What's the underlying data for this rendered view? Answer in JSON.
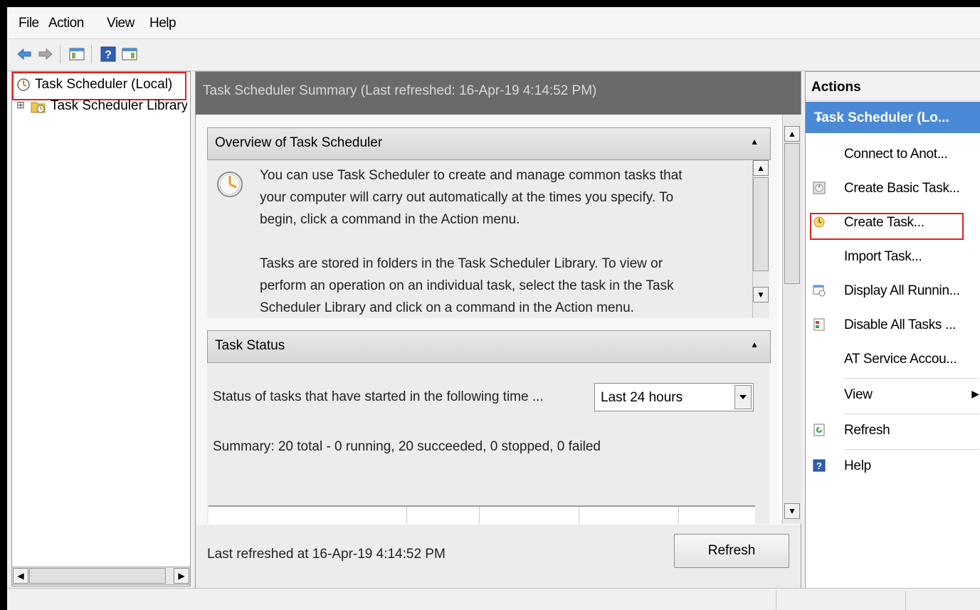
{
  "menu": [
    "File",
    "Action",
    "View",
    "Help"
  ],
  "toolbar": {
    "buttons": [
      "back-arrow-icon",
      "forward-arrow-icon",
      "show-hide-console-tree-icon",
      "help-icon",
      "show-hide-action-pane-icon"
    ]
  },
  "tree": {
    "items": [
      {
        "label": "Task Scheduler (Local)",
        "icon": "clock-icon"
      },
      {
        "label": "Task Scheduler Library",
        "icon": "folder-clock-icon",
        "expander": "⊞"
      }
    ]
  },
  "main": {
    "header": "Task Scheduler Summary (Last refreshed: 16-Apr-19 4:14:52 PM)",
    "overview": {
      "title": "Overview of Task Scheduler",
      "line1": "You can use Task Scheduler to create and manage common tasks that",
      "line2": "your computer will carry out automatically at the times you specify. To",
      "line3": "begin, click a command in the Action menu.",
      "line4": "Tasks are stored in folders in the Task Scheduler Library. To view or",
      "line5": "perform an operation on an individual task, select the task in the Task",
      "line6": "Scheduler Library and click on a command in the Action menu."
    },
    "status": {
      "title": "Task Status",
      "prompt": "Status of tasks that have started in the following time ...",
      "range_value": "Last 24 hours",
      "summary": "Summary: 20 total - 0 running, 20 succeeded, 0 stopped, 0 failed"
    },
    "footer": {
      "last_refreshed": "Last refreshed at 16-Apr-19 4:14:52 PM",
      "refresh_label": "Refresh"
    }
  },
  "actions": {
    "header": "Actions",
    "group": "Task Scheduler (Lo...",
    "items": [
      {
        "label": "Connect to Anot...",
        "icon": ""
      },
      {
        "label": "Create Basic Task...",
        "icon": "wizard-icon"
      },
      {
        "label": "Create Task...",
        "icon": "create-task-icon"
      },
      {
        "label": "Import Task...",
        "icon": ""
      },
      {
        "label": "Display All Runnin...",
        "icon": "running-tasks-icon"
      },
      {
        "label": "Disable All Tasks ...",
        "icon": "disable-icon"
      },
      {
        "label": "AT Service Accou...",
        "icon": ""
      },
      {
        "label": "View",
        "icon": ""
      },
      {
        "label": "Refresh",
        "icon": "refresh-icon"
      },
      {
        "label": "Help",
        "icon": "help-icon"
      }
    ]
  },
  "colors": {
    "selection_blue": "#4a89d6",
    "header_gray": "#6a6a6a",
    "highlight_red": "#e02020"
  }
}
